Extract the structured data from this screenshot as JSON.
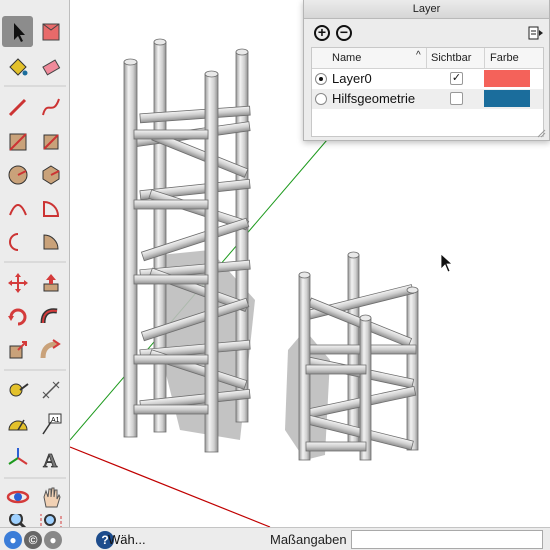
{
  "layer_panel": {
    "title": "Layer",
    "columns": {
      "name": "Name",
      "visible": "Sichtbar",
      "color": "Farbe"
    },
    "layers": [
      {
        "name": "Layer0",
        "active": true,
        "visible": true,
        "visible_mark": "✓",
        "color": "#f4625a"
      },
      {
        "name": "Hilfsgeometrie",
        "active": false,
        "visible": false,
        "visible_mark": "",
        "color": "#1b6d9c"
      }
    ]
  },
  "status": {
    "hint": "Wäh...",
    "measure_label": "Maßangaben",
    "measure_value": ""
  },
  "toolbar_icons": [
    "select-icon",
    "component-icon",
    "paint-bucket-icon",
    "eraser-icon",
    "pencil-icon",
    "freehand-icon",
    "rectangle-icon",
    "rotated-rectangle-icon",
    "circle-icon",
    "polygon-icon",
    "arc-icon",
    "pie-icon",
    "two-point-arc-icon",
    "three-point-arc-icon",
    "move-icon",
    "push-pull-icon",
    "rotate-icon",
    "follow-me-icon",
    "scale-icon",
    "offset-icon",
    "tape-measure-icon",
    "dimension-icon",
    "protractor-icon",
    "text-icon",
    "axes-icon",
    "3d-text-icon",
    "orbit-icon",
    "pan-icon",
    "zoom-icon",
    "zoom-extents-icon"
  ],
  "colors": {
    "red_axis": "#c00000",
    "green_axis": "#1d9a1d",
    "truss": "#c9c9c9",
    "shadow": "#b8b8b8"
  }
}
